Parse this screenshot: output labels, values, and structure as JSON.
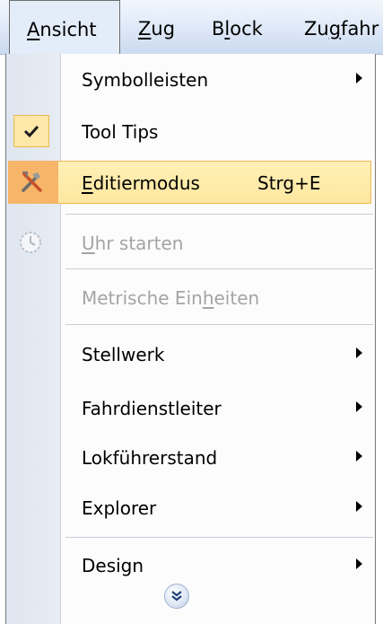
{
  "menubar": {
    "items": [
      {
        "mnemonic": "A",
        "rest": "nsicht"
      },
      {
        "mnemonic": "Z",
        "rest": "ug"
      },
      {
        "pre": "B",
        "mnemonic": "l",
        "rest": "ock"
      },
      {
        "pre": "Zu",
        "mnemonic": "g",
        "rest": "fahr"
      }
    ]
  },
  "menu": {
    "items": [
      {
        "label": "Symbolleisten",
        "submenu": true
      },
      {
        "label": "Tool Tips",
        "checked": true
      },
      {
        "mnemonic": "E",
        "rest": "ditiermodus",
        "shortcut": "Strg+E",
        "highlighted": true,
        "icon": "tools-icon"
      },
      {
        "mnemonic": "U",
        "rest": "hr starten",
        "disabled": true,
        "icon": "clock-icon"
      },
      {
        "pre": "Metrische Ein",
        "mnemonic": "h",
        "rest": "eiten",
        "disabled": true
      },
      {
        "label": "Stellwerk",
        "submenu": true
      },
      {
        "label": "Fahrdienstleiter",
        "submenu": true
      },
      {
        "label": "Lokführerstand",
        "submenu": true
      },
      {
        "label": "Explorer",
        "submenu": true
      },
      {
        "label": "Design",
        "submenu": true
      }
    ],
    "expand_icon": "double-chevron-down-icon"
  },
  "colors": {
    "highlight": "#fde7a0",
    "highlight_border": "#f0b855",
    "gutter": "#e3e9f1",
    "disabled_text": "#a4a4a4"
  }
}
